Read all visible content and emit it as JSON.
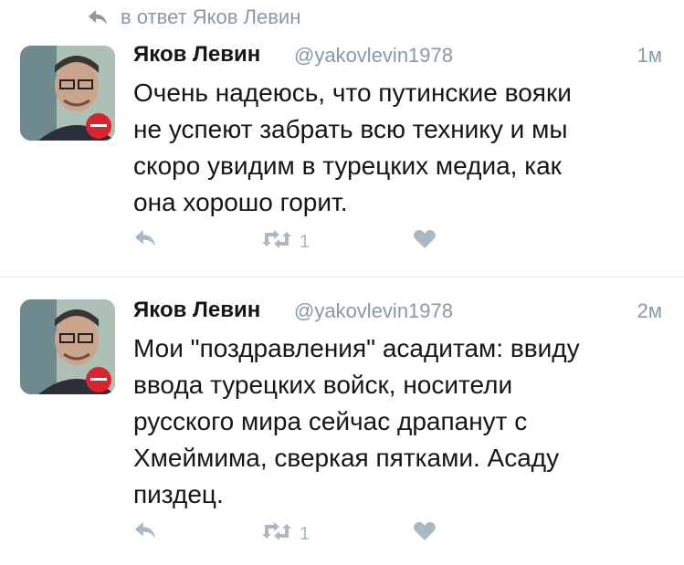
{
  "reply_context": {
    "text": "в ответ Яков Левин",
    "icon": "reply-arrow-icon"
  },
  "tweets": [
    {
      "name": "Яков Левин",
      "handle": "@yakovlevin1978",
      "time": "1м",
      "text": "Очень надеюсь, что путинские вояки\nне успеют забрать всю технику и мы\nскоро увидим в турецких медиа, как\nона хорошо горит.",
      "retweet_count": "1"
    },
    {
      "name": "Яков Левин",
      "handle": "@yakovlevin1978",
      "time": "2м",
      "text": "Мои \"поздравления\" асадитам: ввиду\nввода турецких войск, носители\nрусского мира сейчас драпанут с\nХмеймима, сверкая пятками. Асаду\nпиздец.",
      "retweet_count": "1"
    }
  ],
  "colors": {
    "text": "#14171a",
    "muted": "#8899a6",
    "icon": "#aab8c2",
    "divider": "#e1e8ed"
  }
}
